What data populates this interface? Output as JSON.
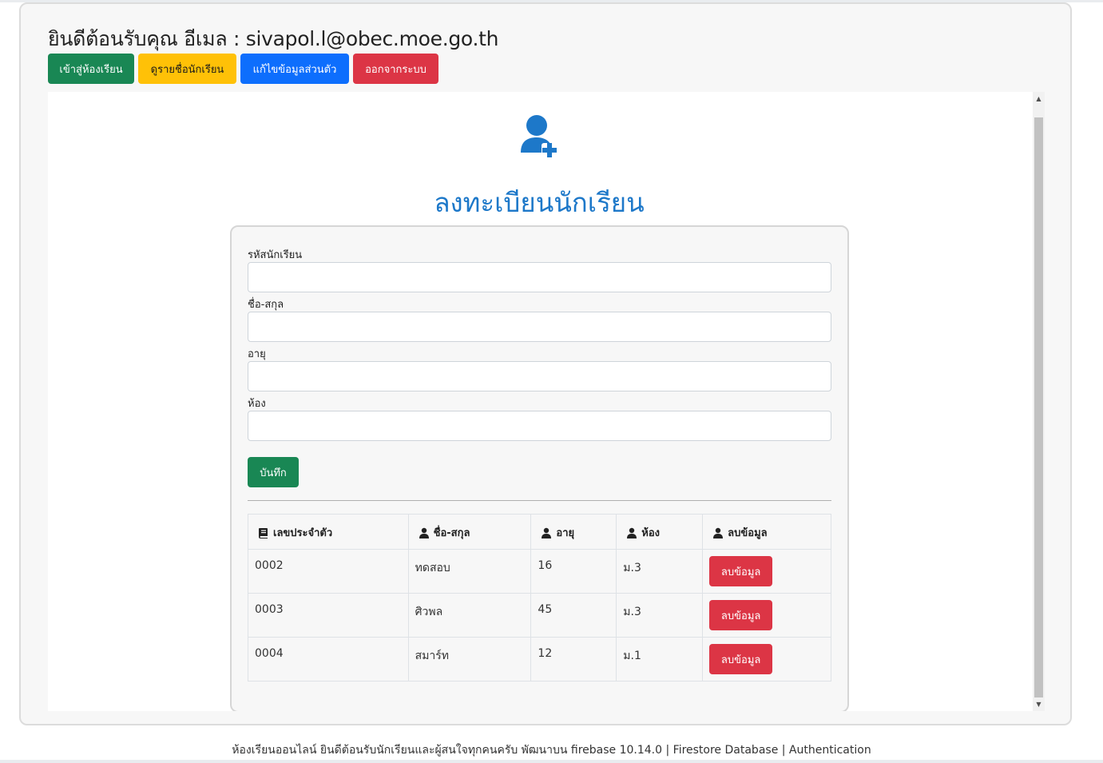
{
  "header": {
    "welcome_text": "ยินดีต้อนรับคุณ อีเมล : sivapol.l@obec.moe.go.th"
  },
  "nav": {
    "enter_class": "เข้าสู่ห้องเรียน",
    "view_students": "ดูรายชื่อนักเรียน",
    "edit_profile": "แก้ไขข้อมูลส่วนตัว",
    "logout": "ออกจากระบบ"
  },
  "colors": {
    "success": "#198754",
    "warning": "#ffc107",
    "primary": "#0d6efd",
    "danger": "#dc3545",
    "title_blue": "#1d78c9"
  },
  "form": {
    "icon": "user-plus-icon",
    "title": "ลงทะเบียนนักเรียน",
    "fields": [
      {
        "label": "รหัสนักเรียน",
        "value": ""
      },
      {
        "label": "ชื่อ-สกุล",
        "value": ""
      },
      {
        "label": "อายุ",
        "value": ""
      },
      {
        "label": "ห้อง",
        "value": ""
      }
    ],
    "save_label": "บันทึก"
  },
  "table": {
    "headers": [
      {
        "label": "เลขประจำตัว",
        "icon": "book-icon"
      },
      {
        "label": "ชื่อ-สกุล",
        "icon": "user-icon"
      },
      {
        "label": "อายุ",
        "icon": "user-icon"
      },
      {
        "label": "ห้อง",
        "icon": "user-icon"
      },
      {
        "label": "ลบข้อมูล",
        "icon": "user-icon"
      }
    ],
    "rows": [
      {
        "id": "0002",
        "name": "ทดสอบ",
        "age": "16",
        "room": "ม.3",
        "delete_label": "ลบข้อมูล"
      },
      {
        "id": "0003",
        "name": "ศิวพล",
        "age": "45",
        "room": "ม.3",
        "delete_label": "ลบข้อมูล"
      },
      {
        "id": "0004",
        "name": "สมาร์ท",
        "age": "12",
        "room": "ม.1",
        "delete_label": "ลบข้อมูล"
      }
    ]
  },
  "footer": {
    "text": "ห้องเรียนออนไลน์ ยินดีต้อนรับนักเรียนและผู้สนใจทุกคนครับ พัฒนาบน firebase 10.14.0 | Firestore Database | Authentication"
  }
}
